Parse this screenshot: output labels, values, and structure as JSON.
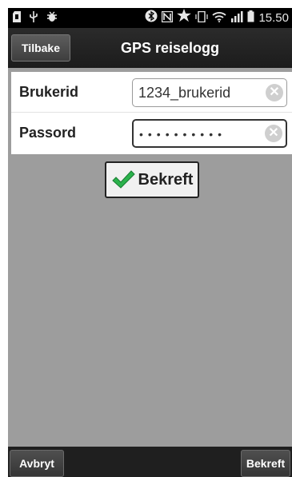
{
  "status_bar": {
    "time": "15.50",
    "left_icons": [
      "sd-card-icon",
      "usb-icon",
      "bug-icon"
    ],
    "right_icons": [
      "bluetooth-icon",
      "nfc-icon",
      "star-icon",
      "vibrate-icon",
      "wifi-icon",
      "signal-icon",
      "battery-icon"
    ]
  },
  "header": {
    "back_label": "Tilbake",
    "title": "GPS reiselogg"
  },
  "form": {
    "user_label": "Brukerid",
    "user_value": "1234_brukerid",
    "password_label": "Passord",
    "password_value": "••••••••••"
  },
  "confirm_button": {
    "label": "Bekreft",
    "icon": "green-checkmark-icon",
    "icon_color": "#2bb24c"
  },
  "bottom_bar": {
    "left_label": "Avbryt",
    "right_label": "Bekreft"
  }
}
